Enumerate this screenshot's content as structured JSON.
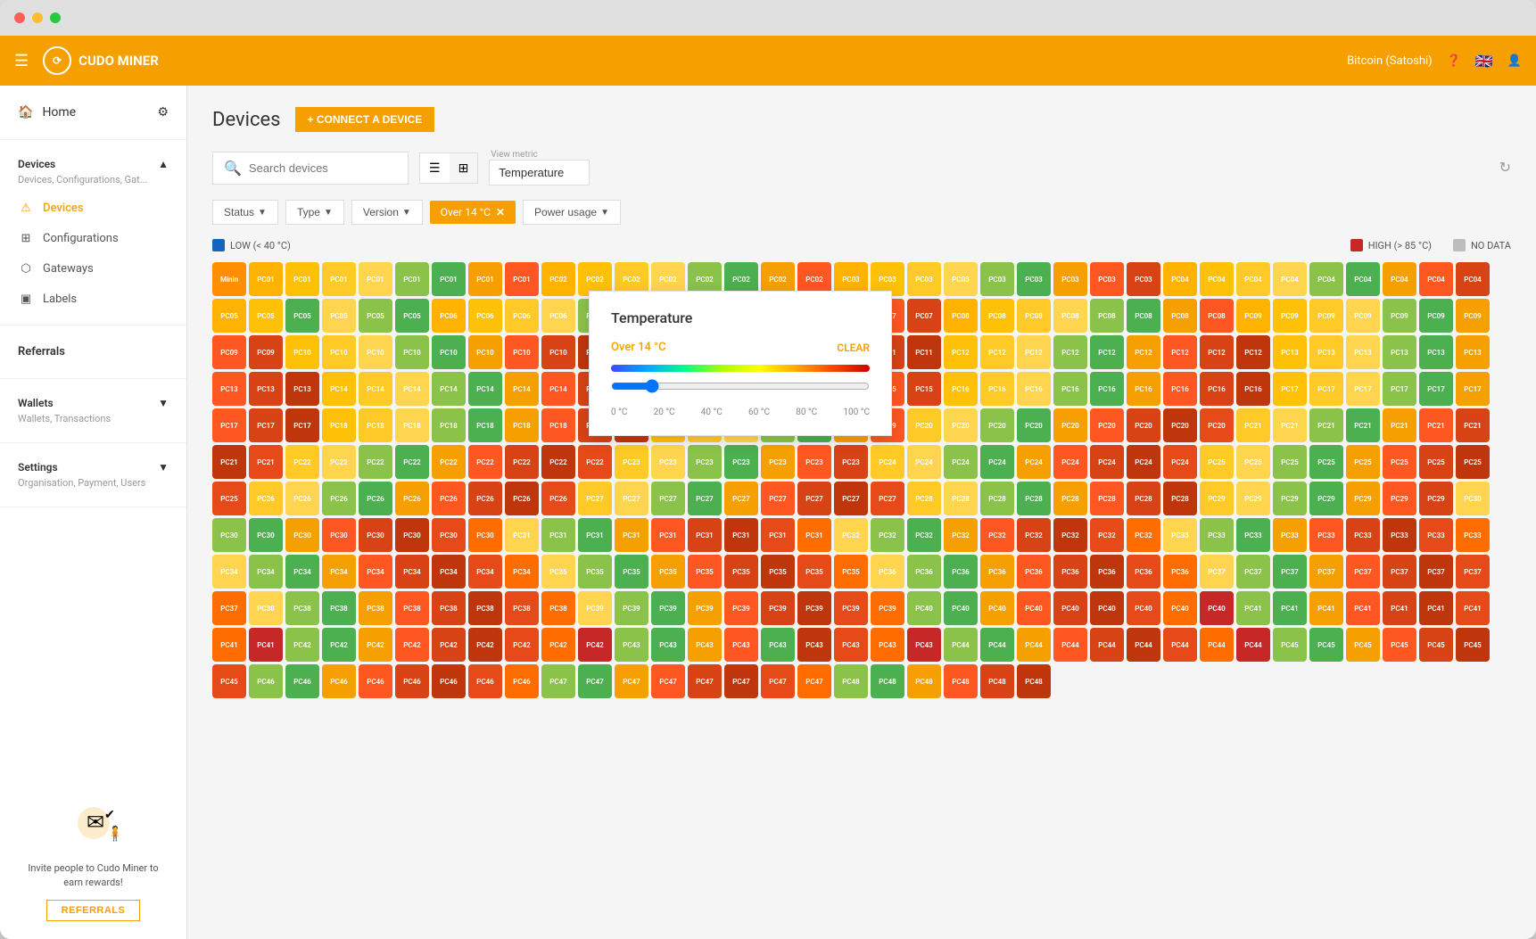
{
  "window": {
    "title": "Cudo Miner"
  },
  "navbar": {
    "logo": "CUDO MINER",
    "bitcoin_label": "Bitcoin (Satoshi)",
    "help_icon": "?",
    "lang": "🇬🇧"
  },
  "sidebar": {
    "home_label": "Home",
    "devices_group": "Devices",
    "devices_sub": "Devices, Configurations, Gat...",
    "items": [
      {
        "id": "devices",
        "label": "Devices",
        "active": true
      },
      {
        "id": "configurations",
        "label": "Configurations"
      },
      {
        "id": "gateways",
        "label": "Gateways"
      },
      {
        "id": "labels",
        "label": "Labels"
      }
    ],
    "referrals_label": "Referrals",
    "wallets_group": "Wallets",
    "wallets_sub": "Wallets, Transactions",
    "settings_group": "Settings",
    "settings_sub": "Organisation, Payment, Users",
    "referral_cta": "Invite people to Cudo Miner to earn rewards!",
    "referral_btn": "REFERRALS"
  },
  "main": {
    "page_title": "Devices",
    "connect_btn": "+ CONNECT A DEVICE",
    "search_placeholder": "Search devices",
    "view_metric_label": "View metric",
    "view_metric_value": "Temperature",
    "filters": {
      "status": "Status",
      "type": "Type",
      "version": "Version",
      "active_filter": "Over 14 °C",
      "power_usage": "Power usage"
    },
    "legend": {
      "low_label": "LOW (< 40 °C)",
      "high_label": "HIGH (> 85 °C)",
      "no_data_label": "NO DATA"
    },
    "temp_popup": {
      "title": "Temperature",
      "filter_text": "Over 14 °C",
      "clear_label": "CLEAR",
      "labels": [
        "0 °C",
        "20 °C",
        "40 °C",
        "60 °C",
        "80 °C",
        "100 °C"
      ]
    }
  },
  "colors": {
    "orange": "#f5a000",
    "red": "#c62828",
    "green": "#4caf50"
  }
}
